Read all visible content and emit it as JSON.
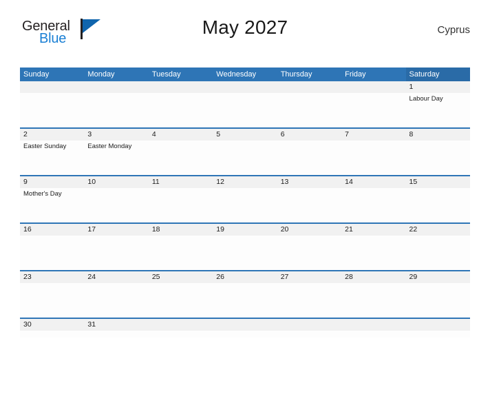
{
  "logo": {
    "word_top": "General",
    "word_bottom": "Blue",
    "flag_color": "#1065ad",
    "text_color": "#231f20",
    "blue_text_color": "#1a7fd4"
  },
  "header": {
    "title": "May 2027",
    "region": "Cyprus"
  },
  "theme": {
    "header_blue": "#2e75b6",
    "saturday_blue": "#2a6ba7",
    "divider_blue": "#2e75b6",
    "band_gray": "#f1f1f1",
    "cell_white": "#fdfdfd"
  },
  "calendar": {
    "weekdays": [
      "Sunday",
      "Monday",
      "Tuesday",
      "Wednesday",
      "Thursday",
      "Friday",
      "Saturday"
    ],
    "weeks": [
      [
        {
          "day": "",
          "events": []
        },
        {
          "day": "",
          "events": []
        },
        {
          "day": "",
          "events": []
        },
        {
          "day": "",
          "events": []
        },
        {
          "day": "",
          "events": []
        },
        {
          "day": "",
          "events": []
        },
        {
          "day": "1",
          "events": [
            "Labour Day"
          ]
        }
      ],
      [
        {
          "day": "2",
          "events": [
            "Easter Sunday"
          ]
        },
        {
          "day": "3",
          "events": [
            "Easter Monday"
          ]
        },
        {
          "day": "4",
          "events": []
        },
        {
          "day": "5",
          "events": []
        },
        {
          "day": "6",
          "events": []
        },
        {
          "day": "7",
          "events": []
        },
        {
          "day": "8",
          "events": []
        }
      ],
      [
        {
          "day": "9",
          "events": [
            "Mother's Day"
          ]
        },
        {
          "day": "10",
          "events": []
        },
        {
          "day": "11",
          "events": []
        },
        {
          "day": "12",
          "events": []
        },
        {
          "day": "13",
          "events": []
        },
        {
          "day": "14",
          "events": []
        },
        {
          "day": "15",
          "events": []
        }
      ],
      [
        {
          "day": "16",
          "events": []
        },
        {
          "day": "17",
          "events": []
        },
        {
          "day": "18",
          "events": []
        },
        {
          "day": "19",
          "events": []
        },
        {
          "day": "20",
          "events": []
        },
        {
          "day": "21",
          "events": []
        },
        {
          "day": "22",
          "events": []
        }
      ],
      [
        {
          "day": "23",
          "events": []
        },
        {
          "day": "24",
          "events": []
        },
        {
          "day": "25",
          "events": []
        },
        {
          "day": "26",
          "events": []
        },
        {
          "day": "27",
          "events": []
        },
        {
          "day": "28",
          "events": []
        },
        {
          "day": "29",
          "events": []
        }
      ],
      [
        {
          "day": "30",
          "events": []
        },
        {
          "day": "31",
          "events": []
        },
        {
          "day": "",
          "events": []
        },
        {
          "day": "",
          "events": []
        },
        {
          "day": "",
          "events": []
        },
        {
          "day": "",
          "events": []
        },
        {
          "day": "",
          "events": []
        }
      ]
    ]
  }
}
